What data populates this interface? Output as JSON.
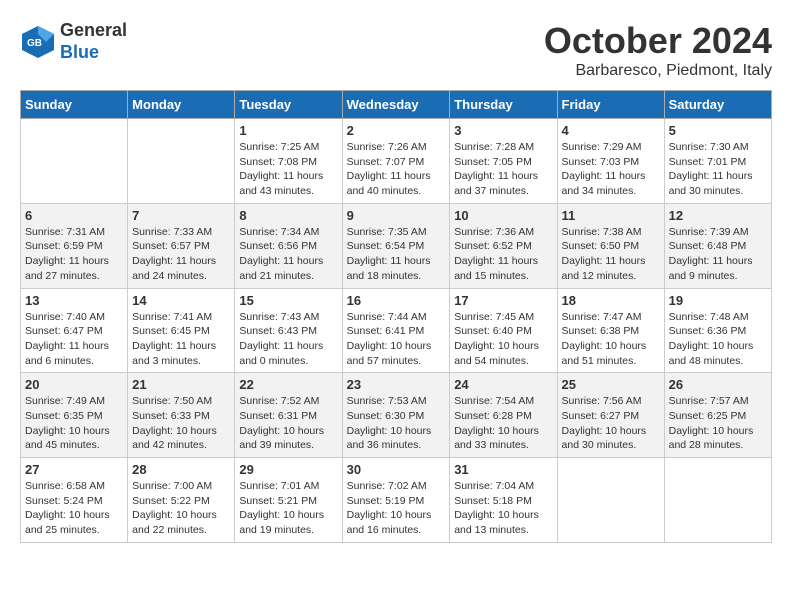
{
  "header": {
    "logo_general": "General",
    "logo_blue": "Blue",
    "month_title": "October 2024",
    "subtitle": "Barbaresco, Piedmont, Italy"
  },
  "days_of_week": [
    "Sunday",
    "Monday",
    "Tuesday",
    "Wednesday",
    "Thursday",
    "Friday",
    "Saturday"
  ],
  "weeks": [
    [
      {
        "day": "",
        "sunrise": "",
        "sunset": "",
        "daylight": ""
      },
      {
        "day": "",
        "sunrise": "",
        "sunset": "",
        "daylight": ""
      },
      {
        "day": "1",
        "sunrise": "Sunrise: 7:25 AM",
        "sunset": "Sunset: 7:08 PM",
        "daylight": "Daylight: 11 hours and 43 minutes."
      },
      {
        "day": "2",
        "sunrise": "Sunrise: 7:26 AM",
        "sunset": "Sunset: 7:07 PM",
        "daylight": "Daylight: 11 hours and 40 minutes."
      },
      {
        "day": "3",
        "sunrise": "Sunrise: 7:28 AM",
        "sunset": "Sunset: 7:05 PM",
        "daylight": "Daylight: 11 hours and 37 minutes."
      },
      {
        "day": "4",
        "sunrise": "Sunrise: 7:29 AM",
        "sunset": "Sunset: 7:03 PM",
        "daylight": "Daylight: 11 hours and 34 minutes."
      },
      {
        "day": "5",
        "sunrise": "Sunrise: 7:30 AM",
        "sunset": "Sunset: 7:01 PM",
        "daylight": "Daylight: 11 hours and 30 minutes."
      }
    ],
    [
      {
        "day": "6",
        "sunrise": "Sunrise: 7:31 AM",
        "sunset": "Sunset: 6:59 PM",
        "daylight": "Daylight: 11 hours and 27 minutes."
      },
      {
        "day": "7",
        "sunrise": "Sunrise: 7:33 AM",
        "sunset": "Sunset: 6:57 PM",
        "daylight": "Daylight: 11 hours and 24 minutes."
      },
      {
        "day": "8",
        "sunrise": "Sunrise: 7:34 AM",
        "sunset": "Sunset: 6:56 PM",
        "daylight": "Daylight: 11 hours and 21 minutes."
      },
      {
        "day": "9",
        "sunrise": "Sunrise: 7:35 AM",
        "sunset": "Sunset: 6:54 PM",
        "daylight": "Daylight: 11 hours and 18 minutes."
      },
      {
        "day": "10",
        "sunrise": "Sunrise: 7:36 AM",
        "sunset": "Sunset: 6:52 PM",
        "daylight": "Daylight: 11 hours and 15 minutes."
      },
      {
        "day": "11",
        "sunrise": "Sunrise: 7:38 AM",
        "sunset": "Sunset: 6:50 PM",
        "daylight": "Daylight: 11 hours and 12 minutes."
      },
      {
        "day": "12",
        "sunrise": "Sunrise: 7:39 AM",
        "sunset": "Sunset: 6:48 PM",
        "daylight": "Daylight: 11 hours and 9 minutes."
      }
    ],
    [
      {
        "day": "13",
        "sunrise": "Sunrise: 7:40 AM",
        "sunset": "Sunset: 6:47 PM",
        "daylight": "Daylight: 11 hours and 6 minutes."
      },
      {
        "day": "14",
        "sunrise": "Sunrise: 7:41 AM",
        "sunset": "Sunset: 6:45 PM",
        "daylight": "Daylight: 11 hours and 3 minutes."
      },
      {
        "day": "15",
        "sunrise": "Sunrise: 7:43 AM",
        "sunset": "Sunset: 6:43 PM",
        "daylight": "Daylight: 11 hours and 0 minutes."
      },
      {
        "day": "16",
        "sunrise": "Sunrise: 7:44 AM",
        "sunset": "Sunset: 6:41 PM",
        "daylight": "Daylight: 10 hours and 57 minutes."
      },
      {
        "day": "17",
        "sunrise": "Sunrise: 7:45 AM",
        "sunset": "Sunset: 6:40 PM",
        "daylight": "Daylight: 10 hours and 54 minutes."
      },
      {
        "day": "18",
        "sunrise": "Sunrise: 7:47 AM",
        "sunset": "Sunset: 6:38 PM",
        "daylight": "Daylight: 10 hours and 51 minutes."
      },
      {
        "day": "19",
        "sunrise": "Sunrise: 7:48 AM",
        "sunset": "Sunset: 6:36 PM",
        "daylight": "Daylight: 10 hours and 48 minutes."
      }
    ],
    [
      {
        "day": "20",
        "sunrise": "Sunrise: 7:49 AM",
        "sunset": "Sunset: 6:35 PM",
        "daylight": "Daylight: 10 hours and 45 minutes."
      },
      {
        "day": "21",
        "sunrise": "Sunrise: 7:50 AM",
        "sunset": "Sunset: 6:33 PM",
        "daylight": "Daylight: 10 hours and 42 minutes."
      },
      {
        "day": "22",
        "sunrise": "Sunrise: 7:52 AM",
        "sunset": "Sunset: 6:31 PM",
        "daylight": "Daylight: 10 hours and 39 minutes."
      },
      {
        "day": "23",
        "sunrise": "Sunrise: 7:53 AM",
        "sunset": "Sunset: 6:30 PM",
        "daylight": "Daylight: 10 hours and 36 minutes."
      },
      {
        "day": "24",
        "sunrise": "Sunrise: 7:54 AM",
        "sunset": "Sunset: 6:28 PM",
        "daylight": "Daylight: 10 hours and 33 minutes."
      },
      {
        "day": "25",
        "sunrise": "Sunrise: 7:56 AM",
        "sunset": "Sunset: 6:27 PM",
        "daylight": "Daylight: 10 hours and 30 minutes."
      },
      {
        "day": "26",
        "sunrise": "Sunrise: 7:57 AM",
        "sunset": "Sunset: 6:25 PM",
        "daylight": "Daylight: 10 hours and 28 minutes."
      }
    ],
    [
      {
        "day": "27",
        "sunrise": "Sunrise: 6:58 AM",
        "sunset": "Sunset: 5:24 PM",
        "daylight": "Daylight: 10 hours and 25 minutes."
      },
      {
        "day": "28",
        "sunrise": "Sunrise: 7:00 AM",
        "sunset": "Sunset: 5:22 PM",
        "daylight": "Daylight: 10 hours and 22 minutes."
      },
      {
        "day": "29",
        "sunrise": "Sunrise: 7:01 AM",
        "sunset": "Sunset: 5:21 PM",
        "daylight": "Daylight: 10 hours and 19 minutes."
      },
      {
        "day": "30",
        "sunrise": "Sunrise: 7:02 AM",
        "sunset": "Sunset: 5:19 PM",
        "daylight": "Daylight: 10 hours and 16 minutes."
      },
      {
        "day": "31",
        "sunrise": "Sunrise: 7:04 AM",
        "sunset": "Sunset: 5:18 PM",
        "daylight": "Daylight: 10 hours and 13 minutes."
      },
      {
        "day": "",
        "sunrise": "",
        "sunset": "",
        "daylight": ""
      },
      {
        "day": "",
        "sunrise": "",
        "sunset": "",
        "daylight": ""
      }
    ]
  ]
}
